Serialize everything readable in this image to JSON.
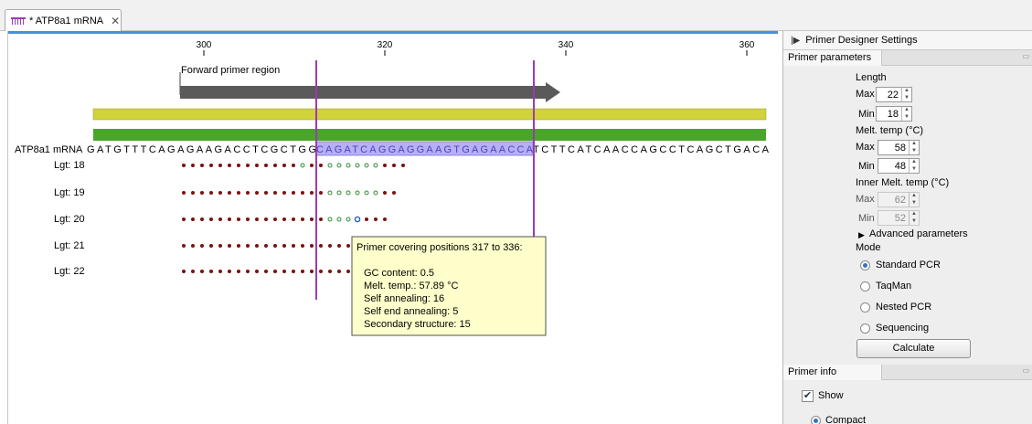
{
  "tab": {
    "title": "* ATP8a1 mRNA",
    "close": "✕"
  },
  "ruler": {
    "ticks": [
      "300",
      "320",
      "340",
      "360"
    ]
  },
  "region": {
    "label": "Forward primer region"
  },
  "sequence": {
    "name": "ATP8a1 mRNA",
    "left": "GATGTTTCAGAGAAGACCTCGCTGG",
    "selected": "CAGATCAGGAGGAAGTGAGAACCA",
    "right": "TCTTCATCAACCAGCCTCAGCTGACA"
  },
  "rows": [
    {
      "label": "Lgt: 18"
    },
    {
      "label": "Lgt: 19"
    },
    {
      "label": "Lgt: 20"
    },
    {
      "label": "Lgt: 21"
    },
    {
      "label": "Lgt: 22"
    }
  ],
  "tooltip": {
    "title": "Primer covering positions 317 to 336:",
    "gc": "GC content: 0.5",
    "melt": "Melt. temp.: 57.89 °C",
    "self_annealing": "Self annealing: 16",
    "self_end": "Self end annealing: 5",
    "secondary": "Secondary structure: 15"
  },
  "panel": {
    "title": "Primer Designer Settings",
    "params_header": "Primer parameters",
    "length_label": "Length",
    "max_label": "Max",
    "min_label": "Min",
    "length_max": "22",
    "length_min": "18",
    "melt_label": "Melt. temp (°C)",
    "melt_max": "58",
    "melt_min": "48",
    "inner_label": "Inner Melt. temp (°C)",
    "inner_max": "62",
    "inner_min": "52",
    "advanced": "Advanced parameters",
    "mode_label": "Mode",
    "modes": [
      "Standard PCR",
      "TaqMan",
      "Nested PCR",
      "Sequencing"
    ],
    "calculate": "Calculate",
    "info_header": "Primer info",
    "show": "Show",
    "compact": "Compact"
  },
  "colors": {
    "accent": "#4b8fd6",
    "marker": "#9b3bb0",
    "dot": "#7a1212",
    "green_dot": "#2e8b2e",
    "yellow_bar": "#d2d23a",
    "green_bar": "#4aa52b",
    "arrow": "#5a5a5a",
    "selection": "#b7b0f2",
    "tooltip_bg": "#ffffcc"
  }
}
